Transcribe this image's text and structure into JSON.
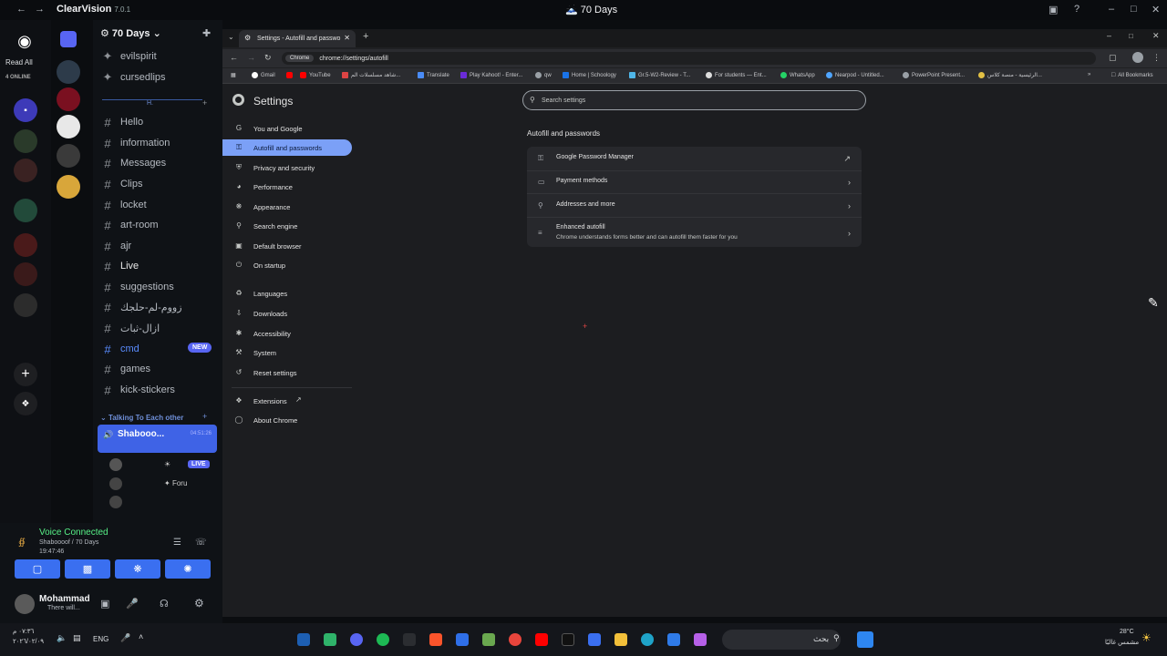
{
  "topbar": {
    "app_name": "ClearVision",
    "app_version": "7.0.1",
    "center_title": "70 Days"
  },
  "discord": {
    "read_all": "Read All",
    "online": "4 ONLINE",
    "server_name": "70 Days",
    "pinned_servers": [
      "evilspirit",
      "cursedlips"
    ],
    "category": "H.",
    "channels": [
      "Hello",
      "information",
      "Messages",
      "Clips",
      "locket",
      "art-room",
      "ajr",
      "Live",
      "suggestions",
      "زووم-لم-حلجك",
      "ازال-ثبات",
      "cmd",
      "games",
      "kick-stickers"
    ],
    "new_badge": "NEW",
    "voice_category": "Talking To Each other",
    "voice_channel": "Shabooo...",
    "voice_timer": "04:51:26",
    "live_badge": "LIVE",
    "voice_user": "Foru",
    "voice_connected": "Voice Connected",
    "voice_location": "Shaboooof / 70 Days",
    "voice_time": "19:47:46",
    "user_name": "Mohammad",
    "user_status": "There will..."
  },
  "chrome": {
    "tab_title": "Settings - Autofill and passwo",
    "chip": "Chrome",
    "url": "chrome://settings/autofill",
    "bookmarks": [
      "Gmail",
      "YouTube",
      "شاهد مسلسلات الم...",
      "Translate",
      "Play Kahoot! - Enter...",
      "qw",
      "Home | Schoology",
      "Gr.5-W2-Review - T...",
      "For students — Ent...",
      "WhatsApp",
      "Nearpod - Untitled...",
      "PowerPoint Present...",
      "الرئيسية - منصة كلاس..."
    ],
    "all_bookmarks": "All Bookmarks",
    "settings_title": "Settings",
    "search_placeholder": "Search settings",
    "nav": [
      "You and Google",
      "Autofill and passwords",
      "Privacy and security",
      "Performance",
      "Appearance",
      "Search engine",
      "Default browser",
      "On startup",
      "Languages",
      "Downloads",
      "Accessibility",
      "System",
      "Reset settings",
      "Extensions",
      "About Chrome"
    ],
    "section_title": "Autofill and passwords",
    "rows": {
      "pm": "Google Password Manager",
      "payment": "Payment methods",
      "addresses": "Addresses and more",
      "enhanced": "Enhanced autofill",
      "enhanced_desc": "Chrome understands forms better and can autofill them faster for you"
    }
  },
  "taskbar": {
    "time": "٠٧:٣٦ م",
    "date": "٢٠٢٦/٠٢/٠٩",
    "lang": "ENG",
    "search": "بحث",
    "temp": "28°C",
    "weather": "مشمس غالبًا"
  }
}
